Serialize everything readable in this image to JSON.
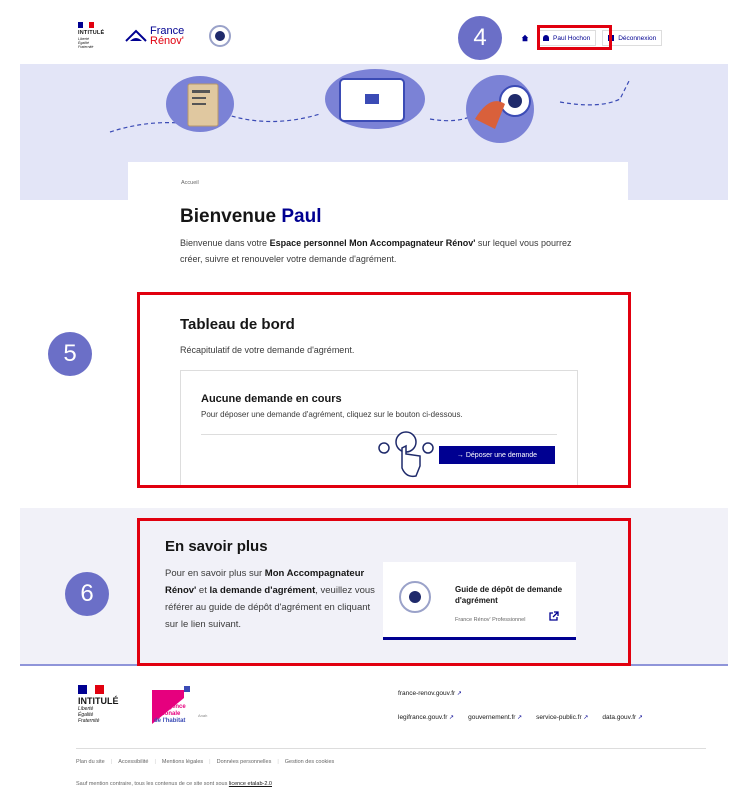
{
  "header": {
    "gov_intitule": "INTITULÉ",
    "gov_devise": [
      "Liberté",
      "Égalité",
      "Fraternité"
    ],
    "brand_line1": "France",
    "brand_line2": "Rénov'",
    "user_button": "Paul Hochon",
    "logout_button": "Déconnexion"
  },
  "annotations": {
    "badge_4": "4",
    "badge_5": "5",
    "badge_6": "6"
  },
  "breadcrumb": "Accueil",
  "welcome": {
    "title_prefix": "Bienvenue ",
    "title_name": "Paul",
    "text_before": "Bienvenue dans votre ",
    "text_bold": "Espace personnel Mon Accompagnateur Rénov'",
    "text_after": " sur lequel vous pourrez créer, suivre et renouveler votre demande d'agrément."
  },
  "dashboard": {
    "title": "Tableau de bord",
    "subtitle": "Récapitulatif de votre demande d'agrément.",
    "card_title": "Aucune demande en cours",
    "card_text": "Pour déposer une demande d'agrément, cliquez sur le bouton ci-dessous.",
    "button": "→  Déposer une demande"
  },
  "learn_more": {
    "title": "En savoir plus",
    "text_1": "Pour en savoir plus sur ",
    "bold_1": "Mon Accompagnateur Rénov'",
    "text_2": " et ",
    "bold_2": "la demande d'agrément",
    "text_3": ", veuillez vous référer au guide de dépôt d'agrément en cliquant sur le lien suivant.",
    "guide_title": "Guide de dépôt de demande d'agrément",
    "guide_source": "France Rénov' Professionnel"
  },
  "footer": {
    "intitule": "INTITULÉ",
    "devise": [
      "Liberté",
      "Égalité",
      "Fraternité"
    ],
    "anah_l1": "Agence",
    "anah_l2": "nationale",
    "anah_l3": "de l'habitat",
    "anah_small": "Anah",
    "link_main": "france-renov.gouv.fr",
    "links": [
      "legifrance.gouv.fr",
      "gouvernement.fr",
      "service-public.fr",
      "data.gouv.fr"
    ],
    "bottom_links": [
      "Plan du site",
      "Accessibilité",
      "Mentions légales",
      "Données personnelles",
      "Gestion des cookies"
    ],
    "licence_prefix": "Sauf mention contraire, tous les contenus de ce site sont sous ",
    "licence_link": "licence etalab-2.0"
  },
  "colors": {
    "primary": "#000091",
    "marianne_red": "#e1000f",
    "highlight": "#e1000f",
    "badge": "#6b6fc7",
    "banner": "#e3e5f7",
    "anah_pink": "#e6007e"
  },
  "icons": {
    "home": "home-icon",
    "user": "user-icon",
    "logout": "logout-icon",
    "external": "external-link-icon"
  }
}
